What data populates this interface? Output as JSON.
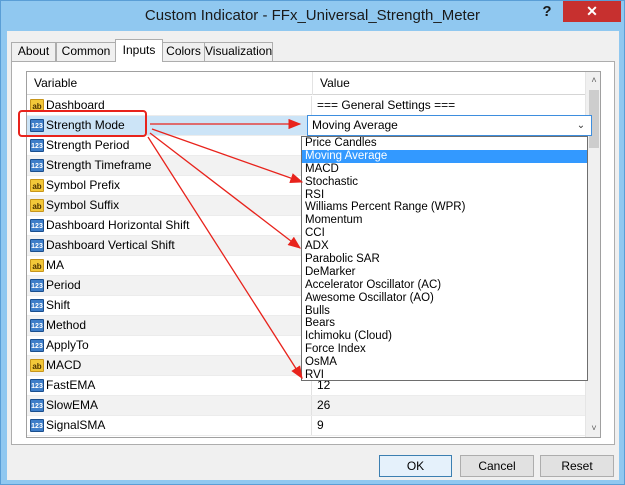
{
  "window": {
    "title": "Custom Indicator - FFx_Universal_Strength_Meter",
    "help_label": "?",
    "close_label": "✕"
  },
  "tabs": [
    {
      "label": "About"
    },
    {
      "label": "Common"
    },
    {
      "label": "Inputs",
      "active": true
    },
    {
      "label": "Colors"
    },
    {
      "label": "Visualization"
    }
  ],
  "grid": {
    "header_variable": "Variable",
    "header_value": "Value",
    "rows": [
      {
        "icon": "ab",
        "label": "Dashboard",
        "value": "=== General Settings ==="
      },
      {
        "icon": "num",
        "label": "Strength Mode",
        "value": "Moving Average"
      },
      {
        "icon": "num",
        "label": "Strength Period",
        "value": ""
      },
      {
        "icon": "num",
        "label": "Strength Timeframe",
        "value": ""
      },
      {
        "icon": "ab",
        "label": "Symbol Prefix",
        "value": ""
      },
      {
        "icon": "ab",
        "label": "Symbol Suffix",
        "value": ""
      },
      {
        "icon": "num",
        "label": "Dashboard Horizontal Shift",
        "value": ""
      },
      {
        "icon": "num",
        "label": "Dashboard Vertical Shift",
        "value": ""
      },
      {
        "icon": "ab",
        "label": "MA",
        "value": ""
      },
      {
        "icon": "num",
        "label": "Period",
        "value": ""
      },
      {
        "icon": "num",
        "label": "Shift",
        "value": ""
      },
      {
        "icon": "num",
        "label": "Method",
        "value": ""
      },
      {
        "icon": "num",
        "label": "ApplyTo",
        "value": ""
      },
      {
        "icon": "ab",
        "label": "MACD",
        "value": ""
      },
      {
        "icon": "num",
        "label": "FastEMA",
        "value": "12"
      },
      {
        "icon": "num",
        "label": "SlowEMA",
        "value": "26"
      },
      {
        "icon": "num",
        "label": "SignalSMA",
        "value": "9"
      }
    ]
  },
  "icons": {
    "ab_text": "ab",
    "num_text": "123",
    "ab_color": "#f3c839",
    "num_color": "#3e7ec9"
  },
  "combo": {
    "value": "Moving Average",
    "arrow": "⌄"
  },
  "dropdown": {
    "selected_index": 1,
    "options": [
      "Price Candles",
      "Moving Average",
      "MACD",
      "Stochastic",
      "RSI",
      "Williams Percent Range (WPR)",
      "Momentum",
      "CCI",
      "ADX",
      "Parabolic SAR",
      "DeMarker",
      "Accelerator Oscillator (AC)",
      "Awesome Oscillator (AO)",
      "Bulls",
      "Bears",
      "Ichimoku (Cloud)",
      "Force Index",
      "OsMA",
      "RVI"
    ]
  },
  "scrollbar": {
    "up": "˄",
    "down": "˅"
  },
  "buttons": {
    "ok": "OK",
    "cancel": "Cancel",
    "reset": "Reset"
  },
  "annotation_color": "#e8231c"
}
